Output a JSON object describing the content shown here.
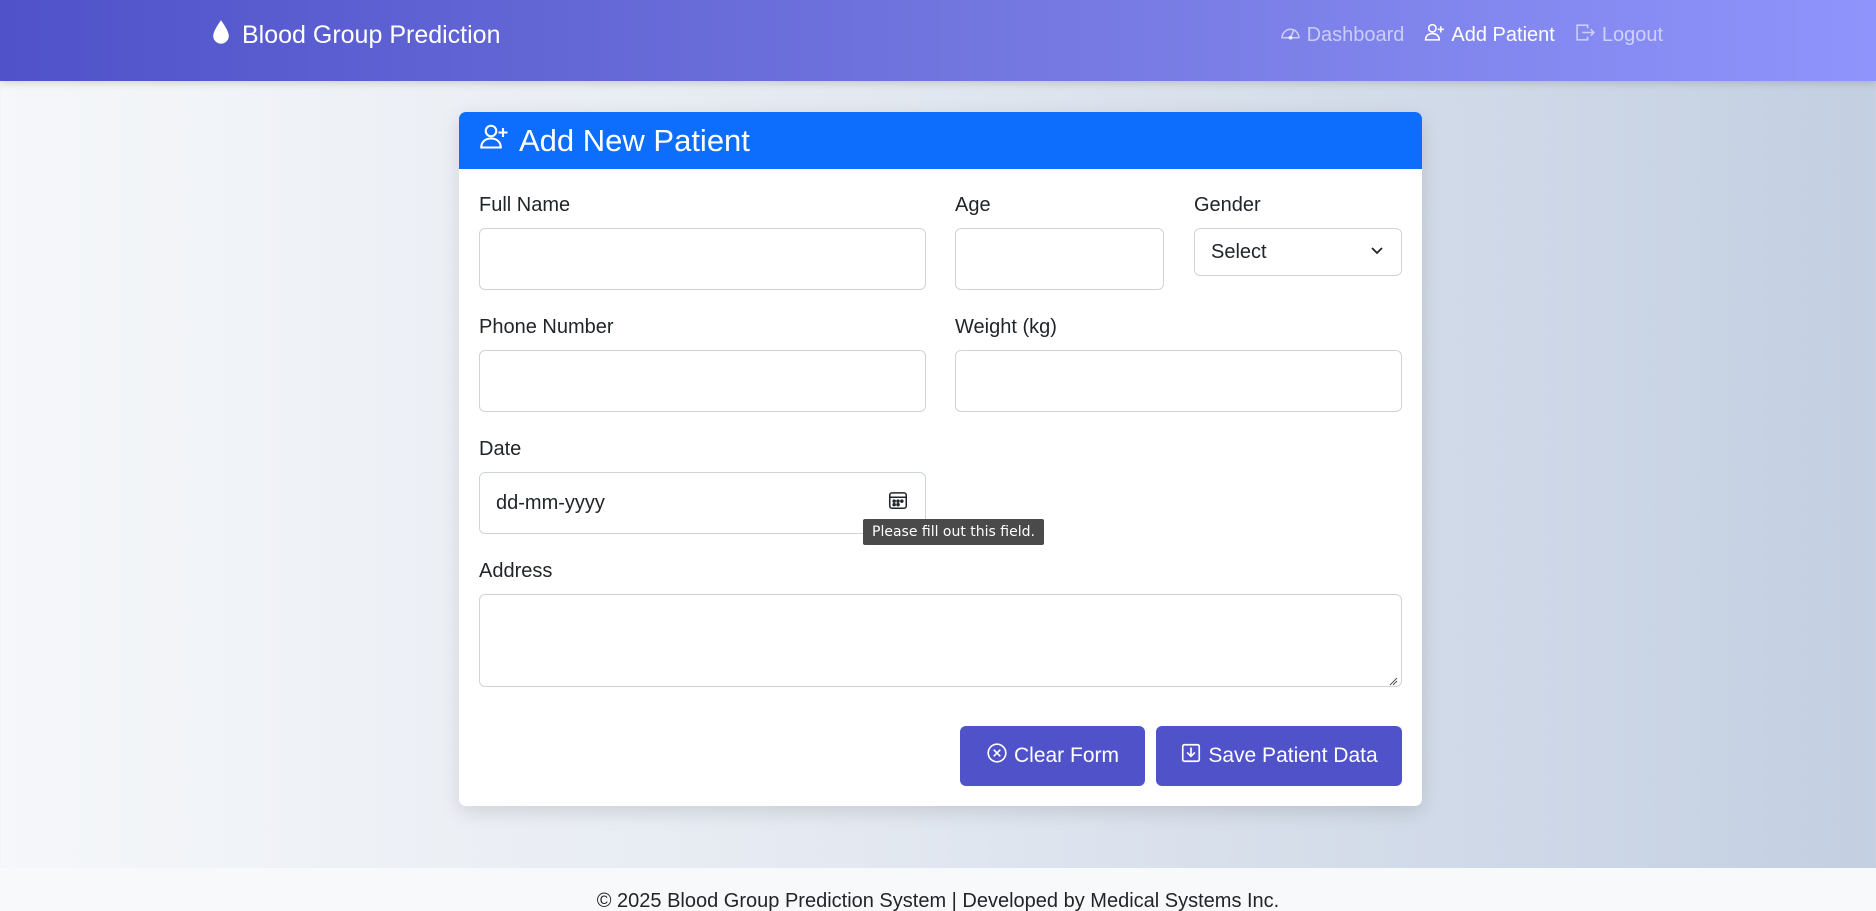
{
  "navbar": {
    "brand": "Blood Group Prediction",
    "links": [
      {
        "label": "Dashboard",
        "icon": "speedometer-icon",
        "active": false
      },
      {
        "label": "Add Patient",
        "icon": "person-plus-icon",
        "active": true
      },
      {
        "label": "Logout",
        "icon": "box-arrow-right-icon",
        "active": false
      }
    ]
  },
  "form": {
    "title": "Add New Patient",
    "fields": {
      "full_name": {
        "label": "Full Name",
        "value": ""
      },
      "age": {
        "label": "Age",
        "value": ""
      },
      "gender": {
        "label": "Gender",
        "selected": "Select"
      },
      "phone": {
        "label": "Phone Number",
        "value": ""
      },
      "weight": {
        "label": "Weight (kg)",
        "value": ""
      },
      "date": {
        "label": "Date",
        "placeholder": "dd-mm-yyyy"
      },
      "address": {
        "label": "Address",
        "value": ""
      }
    },
    "validation_tooltip": "Please fill out this field.",
    "buttons": {
      "clear": "Clear Form",
      "save": "Save Patient Data"
    }
  },
  "footer": {
    "text": "© 2025 Blood Group Prediction System | Developed by Medical Systems Inc."
  },
  "colors": {
    "navbar_start": "#4f52c9",
    "navbar_end": "#8e94fb",
    "card_header": "#0d6efd",
    "button": "#4f52c9"
  }
}
